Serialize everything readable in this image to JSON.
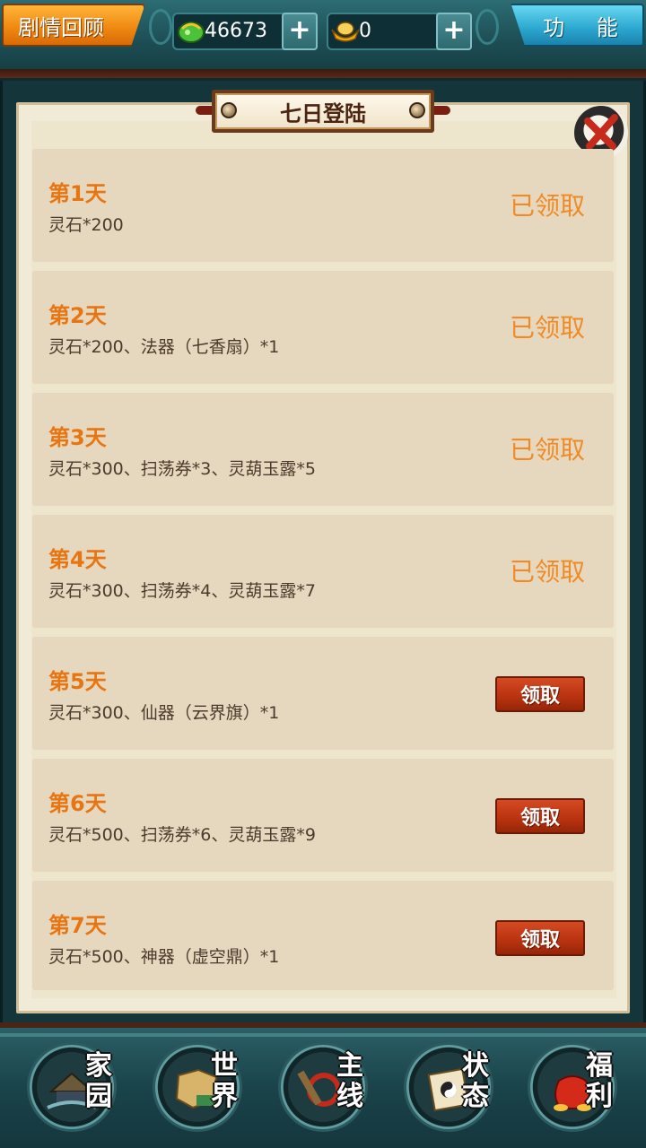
{
  "topbar": {
    "story_label": "剧情回顾",
    "function_label": "功 能",
    "spirit_stone_value": "46673",
    "gold_value": "0",
    "plus_label": "+"
  },
  "dialog": {
    "title": "七日登陆",
    "claimed_label": "已领取",
    "claim_label": "领取",
    "days": [
      {
        "day": "第1天",
        "reward": "灵石*200",
        "status": "claimed"
      },
      {
        "day": "第2天",
        "reward": "灵石*200、法器（七香扇）*1",
        "status": "claimed"
      },
      {
        "day": "第3天",
        "reward": "灵石*300、扫荡券*3、灵葫玉露*5",
        "status": "claimed"
      },
      {
        "day": "第4天",
        "reward": "灵石*300、扫荡券*4、灵葫玉露*7",
        "status": "claimed"
      },
      {
        "day": "第5天",
        "reward": "灵石*300、仙器（云界旗）*1",
        "status": "claimable"
      },
      {
        "day": "第6天",
        "reward": "灵石*500、扫荡券*6、灵葫玉露*9",
        "status": "claimable"
      },
      {
        "day": "第7天",
        "reward": "灵石*500、神器（虚空鼎）*1",
        "status": "claimable"
      }
    ]
  },
  "bottom_nav": [
    {
      "label_top": "家",
      "label_bottom": "园",
      "icon": "home-icon"
    },
    {
      "label_top": "世",
      "label_bottom": "界",
      "icon": "world-map-icon"
    },
    {
      "label_top": "主",
      "label_bottom": "线",
      "icon": "main-quest-icon"
    },
    {
      "label_top": "状",
      "label_bottom": "态",
      "icon": "status-scroll-icon"
    },
    {
      "label_top": "福",
      "label_bottom": "利",
      "icon": "welfare-bag-icon"
    }
  ],
  "colors": {
    "day_title": "#e87510",
    "claimed_text": "#ef8a24",
    "claim_button": "#b8320f",
    "row_bg": "#e6d7bf"
  }
}
